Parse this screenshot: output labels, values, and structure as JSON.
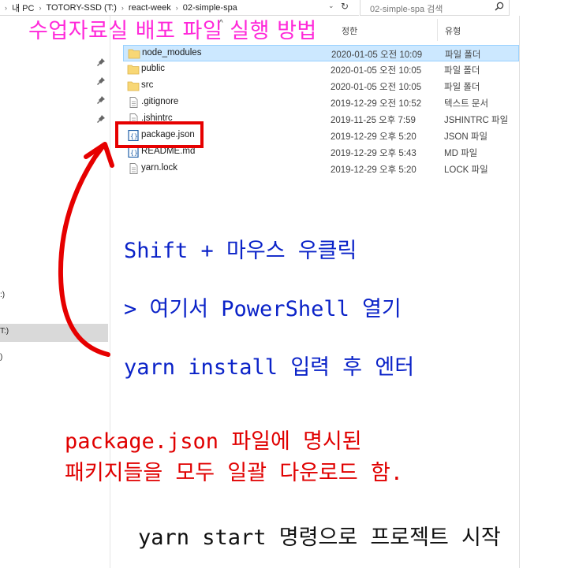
{
  "address": {
    "crumbs": [
      "내 PC",
      "TOTORY-SSD (T:)",
      "react-week",
      "02-simple-spa"
    ],
    "search_placeholder": "02-simple-spa 검색"
  },
  "nav": {
    "fragments": [
      ":)",
      "T:)",
      ")"
    ]
  },
  "columns": {
    "date_fragment": "정한",
    "type": "유형"
  },
  "files": [
    {
      "name": "node_modules",
      "date": "2020-01-05 오전 10:09",
      "type": "파일 폴더",
      "icon": "folder-icon",
      "selected": true
    },
    {
      "name": "public",
      "date": "2020-01-05 오전 10:05",
      "type": "파일 폴더",
      "icon": "folder-icon",
      "selected": false
    },
    {
      "name": "src",
      "date": "2020-01-05 오전 10:05",
      "type": "파일 폴더",
      "icon": "folder-icon",
      "selected": false
    },
    {
      "name": ".gitignore",
      "date": "2019-12-29 오전 10:52",
      "type": "텍스트 문서",
      "icon": "text-file-icon",
      "selected": false
    },
    {
      "name": ".jshintrc",
      "date": "2019-11-25 오후 7:59",
      "type": "JSHINTRC 파일",
      "icon": "text-file-icon",
      "selected": false
    },
    {
      "name": "package.json",
      "date": "2019-12-29 오후 5:20",
      "type": "JSON 파일",
      "icon": "json-file-icon",
      "selected": false
    },
    {
      "name": "README.md",
      "date": "2019-12-29 오후 5:43",
      "type": "MD 파일",
      "icon": "md-file-icon",
      "selected": false
    },
    {
      "name": "yarn.lock",
      "date": "2019-12-29 오후 5:20",
      "type": "LOCK 파일",
      "icon": "text-file-icon",
      "selected": false
    }
  ],
  "annotations": {
    "title": "수업자료실 배포 파일 실행 방법",
    "step1": "Shift + 마우스 우클릭",
    "step2": " > 여기서 PowerShell 열기",
    "step3": "yarn install 입력 후 엔터",
    "note_line1": "package.json 파일에 명시된",
    "note_line2": "패키지들을 모두 일괄 다운로드 함.",
    "step4": "yarn start 명령으로 프로젝트 시작"
  },
  "colors": {
    "title": "#ff28d9",
    "instruction": "#0a22c8",
    "note": "#e00000",
    "highlight": "#e60000",
    "selection": "#cce8ff"
  }
}
